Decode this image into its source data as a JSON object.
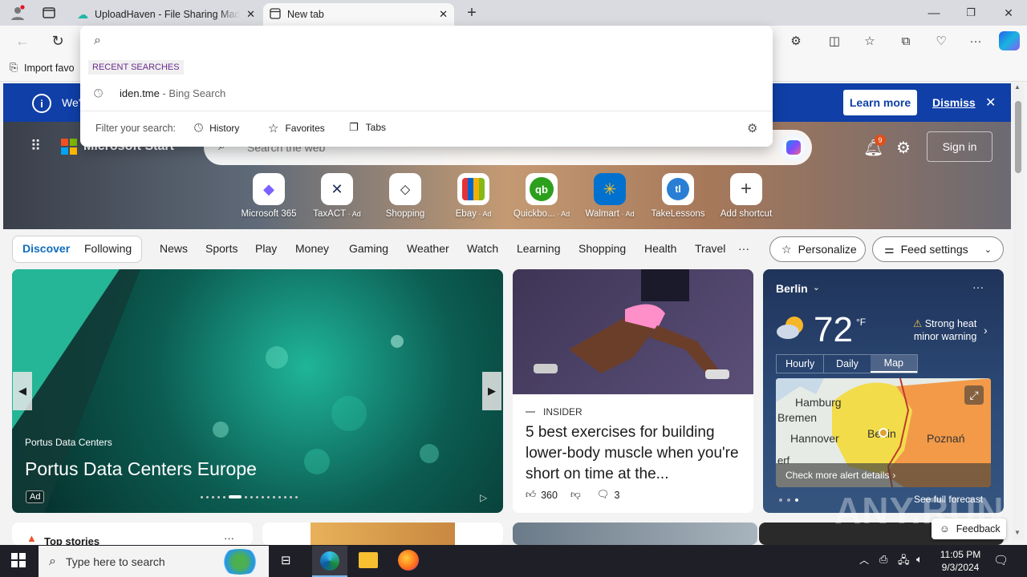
{
  "browser": {
    "tabs": [
      {
        "title": "UploadHaven - File Sharing Made Simple"
      },
      {
        "title": "New tab"
      }
    ],
    "favorites_label": "Import favo"
  },
  "omnibox": {
    "section_title": "RECENT SEARCHES",
    "recent": {
      "query": "iden.tme",
      "suffix": " - Bing Search"
    },
    "filter_label": "Filter your search:",
    "filters": [
      "History",
      "Favorites",
      "Tabs"
    ]
  },
  "banner": {
    "partial_text": "We'",
    "learn_more": "Learn more",
    "dismiss": "Dismiss"
  },
  "page": {
    "brand": "Microsoft Start",
    "search_placeholder": "Search the web",
    "notif_count": "9",
    "sign_in": "Sign in",
    "shortcuts": [
      {
        "label": "Microsoft 365",
        "ad": ""
      },
      {
        "label": "TaxACT",
        "ad": " · Ad"
      },
      {
        "label": "Shopping",
        "ad": ""
      },
      {
        "label": "Ebay",
        "ad": " · Ad"
      },
      {
        "label": "Quickbo...",
        "ad": " · Ad"
      },
      {
        "label": "Walmart",
        "ad": " · Ad"
      },
      {
        "label": "TakeLessons",
        "ad": ""
      },
      {
        "label": "Add shortcut",
        "ad": ""
      }
    ]
  },
  "feed_nav": {
    "discover": "Discover",
    "following": "Following",
    "items": [
      "News",
      "Sports",
      "Play",
      "Money",
      "Gaming",
      "Weather",
      "Watch",
      "Learning",
      "Shopping",
      "Health",
      "Travel"
    ],
    "more": "···",
    "personalize": "Personalize",
    "feed_settings": "Feed settings"
  },
  "hero_card": {
    "source": "Portus Data Centers",
    "title": "Portus Data Centers Europe",
    "ad": "Ad"
  },
  "article": {
    "source": "INSIDER",
    "title": "5 best exercises for building lower-body muscle when you're short on time at the...",
    "likes": "360",
    "comments": "3"
  },
  "weather": {
    "city": "Berlin",
    "temp": "72",
    "unit": "°F",
    "alert_line1": "Strong heat",
    "alert_line2": "minor warning",
    "tabs": [
      "Hourly",
      "Daily",
      "Map"
    ],
    "map_labels": [
      "Hamburg",
      "Bremen",
      "Hannover",
      "Berlin",
      "Poznań",
      "erf"
    ],
    "alert_link": "Check more alert details",
    "forecast": "See full forecast"
  },
  "bottom": {
    "top_stories": "Top stories",
    "feedback": "Feedback"
  },
  "taskbar": {
    "search_placeholder": "Type here to search",
    "time": "11:05 PM",
    "date": "9/3/2024"
  },
  "watermark": "ANY.RUN"
}
